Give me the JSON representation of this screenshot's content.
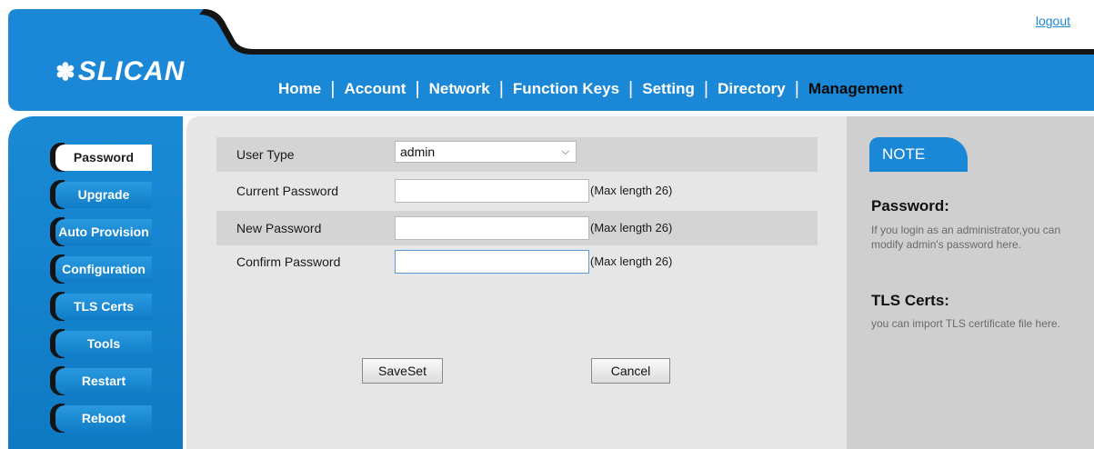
{
  "header": {
    "logout_label": "logout",
    "logo_text": "SLICAN",
    "nav": [
      "Home",
      "Account",
      "Network",
      "Function Keys",
      "Setting",
      "Directory",
      "Management"
    ],
    "active_nav": "Management"
  },
  "sidebar": {
    "items": [
      "Password",
      "Upgrade",
      "Auto Provision",
      "Configuration",
      "TLS Certs",
      "Tools",
      "Restart",
      "Reboot"
    ],
    "active": "Password"
  },
  "form": {
    "user_type": {
      "label": "User Type",
      "value": "admin"
    },
    "current_password": {
      "label": "Current Password",
      "value": "",
      "hint": "(Max length 26)"
    },
    "new_password": {
      "label": "New Password",
      "value": "",
      "hint": "(Max length 26)"
    },
    "confirm_password": {
      "label": "Confirm Password",
      "value": "",
      "hint": "(Max length 26)"
    },
    "save_label": "SaveSet",
    "cancel_label": "Cancel"
  },
  "note": {
    "tab_label": "NOTE",
    "sections": [
      {
        "title": "Password:",
        "text": "If you login as an administrator,you can modify admin's password here."
      },
      {
        "title": "TLS Certs:",
        "text": "you can import TLS certificate file here."
      }
    ]
  },
  "colors": {
    "accent_blue": "#1a88d6",
    "header_dark": "#141414",
    "panel_gray": "#e6e6e6",
    "note_gray": "#cfcfcf"
  }
}
